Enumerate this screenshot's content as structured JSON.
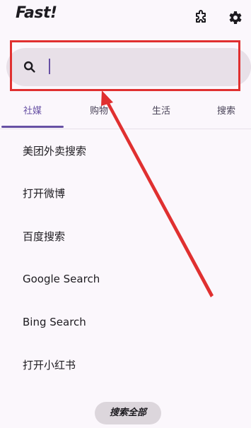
{
  "header": {
    "title": "Fast!"
  },
  "search": {
    "value": "",
    "placeholder": ""
  },
  "tabs": [
    {
      "label": "社媒",
      "active": true
    },
    {
      "label": "购物",
      "active": false
    },
    {
      "label": "生活",
      "active": false
    },
    {
      "label": "搜索",
      "active": false
    }
  ],
  "items": [
    {
      "label": "美团外卖搜索"
    },
    {
      "label": "打开微博"
    },
    {
      "label": "百度搜索"
    },
    {
      "label": "Google Search"
    },
    {
      "label": "Bing Search"
    },
    {
      "label": "打开小红书"
    }
  ],
  "fab": {
    "label": "搜索全部"
  },
  "icons": {
    "extension": "puzzle-extension-icon",
    "settings": "gear-icon",
    "search": "search-icon"
  },
  "colors": {
    "accent": "#6750a4",
    "annotation": "#e03030",
    "background": "#fbf7fc",
    "search_bg": "#e8e0e8"
  }
}
